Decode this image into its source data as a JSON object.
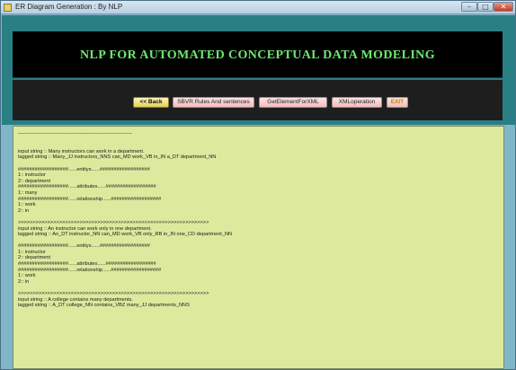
{
  "window": {
    "title": "ER Diagram Generation : By NLP",
    "minimize": "–",
    "maximize": "□",
    "close": "✕"
  },
  "banner": {
    "heading": "NLP FOR AUTOMATED CONCEPTUAL DATA MODELING"
  },
  "toolbar": {
    "back": "<< Back",
    "sbvr": "SBVR Rules And sentences",
    "getelement": "GetElementForXML",
    "xmloperation": "XMLoperation",
    "exit": "EXIT"
  },
  "output": {
    "lines": [
      "--------------------------------------------------------------------",
      "",
      "",
      "input string :: Many instructors can work in a department.",
      "tagged string :: Many_JJ instructors_NNS can_MD work_VB in_IN a_DT department_NN",
      "",
      "##################......entitys......##################",
      "1:: instructor",
      "2:: department",
      "##################......attributes......##################",
      "1:: many",
      "##################......relationship......##################",
      "1:: work",
      "2:: in",
      "",
      ">>>>>>>>>>>>>>>>>>>>>>>>>>>>>>>>>>>>>>>>>>>>>>>>>>>>>>>>>>>>>>>>>",
      "input string :: An instructor can work only in one department.",
      "tagged string :: An_DT instructor_NN can_MD work_VB only_RB in_IN one_CD department_NN",
      "",
      "##################......entitys......##################",
      "1:: instructor",
      "2:: department",
      "##################......attributes......##################",
      "##################......relationship......##################",
      "1:: work",
      "2:: in",
      "",
      ">>>>>>>>>>>>>>>>>>>>>>>>>>>>>>>>>>>>>>>>>>>>>>>>>>>>>>>>>>>>>>>>>",
      "input string :: A college contains many departments.",
      "tagged string :: A_DT college_NN contains_VBZ many_JJ departments_NNS"
    ]
  }
}
